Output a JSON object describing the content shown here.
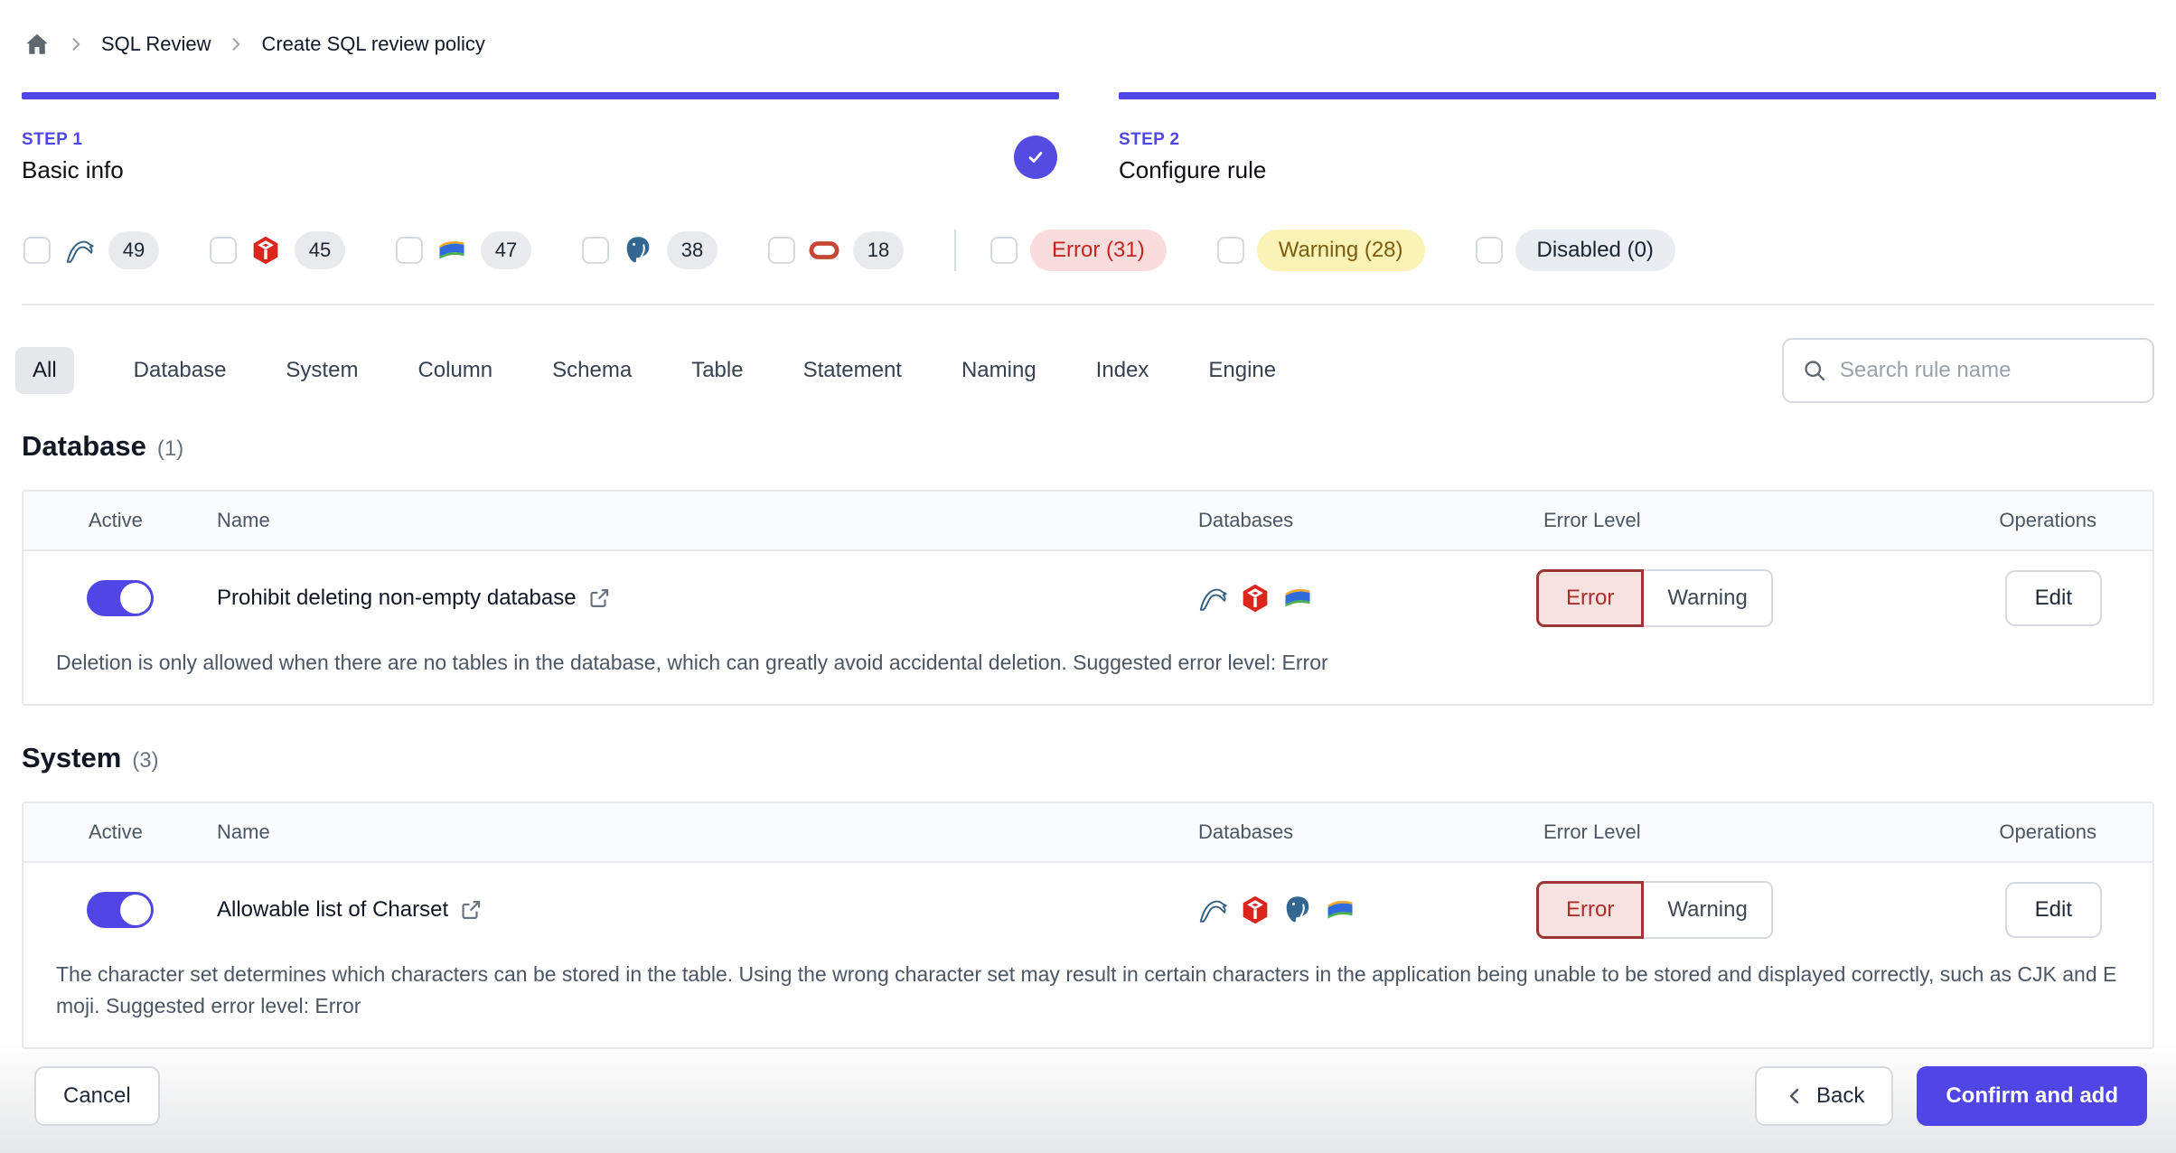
{
  "breadcrumb": {
    "items": [
      "SQL Review",
      "Create SQL review policy"
    ]
  },
  "steps": [
    {
      "step": "STEP 1",
      "title": "Basic info",
      "completed": true
    },
    {
      "step": "STEP 2",
      "title": "Configure rule",
      "completed": false
    }
  ],
  "filters": {
    "engines": [
      {
        "engine": "mysql",
        "count": "49"
      },
      {
        "engine": "tidb",
        "count": "45"
      },
      {
        "engine": "oceanbase",
        "count": "47"
      },
      {
        "engine": "postgresql",
        "count": "38"
      },
      {
        "engine": "oracle",
        "count": "18"
      }
    ],
    "levels": [
      {
        "id": "error",
        "label": "Error (31)"
      },
      {
        "id": "warning",
        "label": "Warning (28)"
      },
      {
        "id": "disabled",
        "label": "Disabled (0)"
      }
    ]
  },
  "tabs": {
    "selected": "All",
    "items": [
      "All",
      "Database",
      "System",
      "Column",
      "Schema",
      "Table",
      "Statement",
      "Naming",
      "Index",
      "Engine"
    ]
  },
  "search": {
    "placeholder": "Search rule name"
  },
  "table_columns": [
    "Active",
    "Name",
    "Databases",
    "Error Level",
    "Operations"
  ],
  "sections": [
    {
      "title": "Database",
      "count": "(1)",
      "rules": [
        {
          "active": true,
          "name": "Prohibit deleting non-empty database",
          "engines": [
            "mysql",
            "tidb",
            "oceanbase"
          ],
          "levels": [
            "Error",
            "Warning"
          ],
          "selected_level": "Error",
          "operation": "Edit",
          "description": "Deletion is only allowed when there are no tables in the database, which can greatly avoid accidental deletion. Suggested error level: Error"
        }
      ]
    },
    {
      "title": "System",
      "count": "(3)",
      "rules": [
        {
          "active": true,
          "name": "Allowable list of Charset",
          "engines": [
            "mysql",
            "tidb",
            "postgresql",
            "oceanbase"
          ],
          "levels": [
            "Error",
            "Warning"
          ],
          "selected_level": "Error",
          "operation": "Edit",
          "description": "The character set determines which characters can be stored in the table. Using the wrong character set may result in certain characters in the application being unable to be stored and displayed correctly, such as CJK and Emoji. Suggested error level: Error"
        }
      ]
    }
  ],
  "footer": {
    "cancel": "Cancel",
    "back": "Back",
    "confirm": "Confirm and add"
  },
  "colors": {
    "accent": "#4f46e5",
    "error_text": "#c2271f",
    "error_bg": "#fadcdc",
    "warning_text": "#7d5c10",
    "warning_bg": "#fbf3b5",
    "disabled_bg": "#e9edf2",
    "error_segment_border": "#9a3634"
  }
}
